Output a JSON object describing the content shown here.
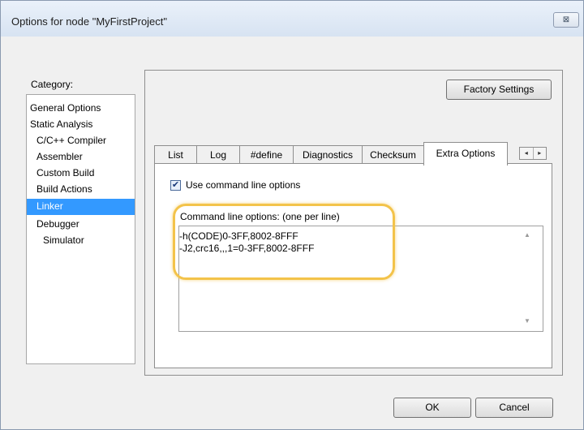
{
  "window": {
    "title": "Options for node \"MyFirstProject\"",
    "close_glyph": "⊠"
  },
  "category": {
    "label": "Category:",
    "items": [
      {
        "label": "General Options"
      },
      {
        "label": "Static Analysis"
      },
      {
        "label": "C/C++ Compiler"
      },
      {
        "label": "Assembler"
      },
      {
        "label": "Custom Build"
      },
      {
        "label": "Build Actions"
      },
      {
        "label": "Linker",
        "selected": true
      },
      {
        "label": "Debugger"
      },
      {
        "label": "Simulator"
      }
    ]
  },
  "factory_settings_label": "Factory Settings",
  "tabs": [
    {
      "label": "List"
    },
    {
      "label": "Log"
    },
    {
      "label": "#define"
    },
    {
      "label": "Diagnostics"
    },
    {
      "label": "Checksum"
    },
    {
      "label": "Extra Options",
      "active": true
    }
  ],
  "tab_scroll": {
    "left": "◂",
    "right": "▸"
  },
  "extra_options": {
    "use_cmd_line_label": "Use command line options",
    "use_cmd_line_checked": true,
    "check_glyph": "✔",
    "cmd_line_label": "Command line options:  (one per line)",
    "cmd_lines": [
      "-h(CODE)0-3FF,8002-8FFF",
      "-J2,crc16,,,1=0-3FF,8002-8FFF"
    ],
    "scroll_up": "▲",
    "scroll_down": "▼"
  },
  "buttons": {
    "ok": "OK",
    "cancel": "Cancel"
  },
  "colors": {
    "selection": "#3399ff",
    "highlight": "#f3c34a"
  }
}
